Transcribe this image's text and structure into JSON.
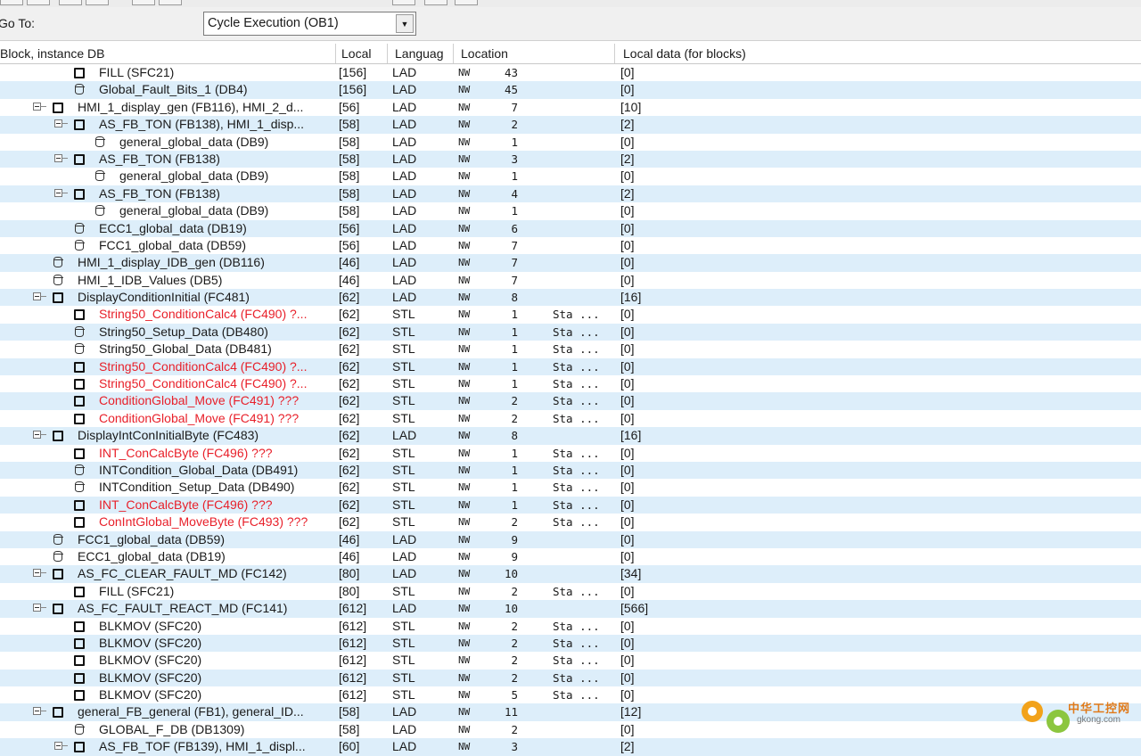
{
  "goto": {
    "label": "Go To:",
    "value": "Cycle Execution (OB1)"
  },
  "columns": [
    "Block, instance DB",
    "Local",
    "Languag",
    "Location",
    "Local data (for blocks)"
  ],
  "rows": [
    {
      "indent": 3,
      "icon": "block",
      "name": "FILL (SFC21)",
      "local": "[156]",
      "lang": "LAD",
      "nw": "NW",
      "num": "43",
      "sta": "",
      "ld": "[0]",
      "red": false
    },
    {
      "indent": 3,
      "icon": "db",
      "name": "Global_Fault_Bits_1 (DB4)",
      "local": "[156]",
      "lang": "LAD",
      "nw": "NW",
      "num": "45",
      "sta": "",
      "ld": "[0]",
      "red": false
    },
    {
      "indent": 2,
      "icon": "block",
      "expand": true,
      "name": "HMI_1_display_gen (FB116), HMI_2_d...",
      "local": "[56]",
      "lang": "LAD",
      "nw": "NW",
      "num": "7",
      "sta": "",
      "ld": "[10]",
      "red": false
    },
    {
      "indent": 3,
      "icon": "block",
      "expand": true,
      "name": "AS_FB_TON (FB138), HMI_1_disp...",
      "local": "[58]",
      "lang": "LAD",
      "nw": "NW",
      "num": "2",
      "sta": "",
      "ld": "[2]",
      "red": false
    },
    {
      "indent": 4,
      "icon": "db",
      "name": "general_global_data (DB9)",
      "local": "[58]",
      "lang": "LAD",
      "nw": "NW",
      "num": "1",
      "sta": "",
      "ld": "[0]",
      "red": false
    },
    {
      "indent": 3,
      "icon": "block",
      "expand": true,
      "name": "AS_FB_TON (FB138)",
      "local": "[58]",
      "lang": "LAD",
      "nw": "NW",
      "num": "3",
      "sta": "",
      "ld": "[2]",
      "red": false
    },
    {
      "indent": 4,
      "icon": "db",
      "name": "general_global_data (DB9)",
      "local": "[58]",
      "lang": "LAD",
      "nw": "NW",
      "num": "1",
      "sta": "",
      "ld": "[0]",
      "red": false
    },
    {
      "indent": 3,
      "icon": "block",
      "expand": true,
      "name": "AS_FB_TON (FB138)",
      "local": "[58]",
      "lang": "LAD",
      "nw": "NW",
      "num": "4",
      "sta": "",
      "ld": "[2]",
      "red": false
    },
    {
      "indent": 4,
      "icon": "db",
      "name": "general_global_data (DB9)",
      "local": "[58]",
      "lang": "LAD",
      "nw": "NW",
      "num": "1",
      "sta": "",
      "ld": "[0]",
      "red": false
    },
    {
      "indent": 3,
      "icon": "db",
      "name": "ECC1_global_data (DB19)",
      "local": "[56]",
      "lang": "LAD",
      "nw": "NW",
      "num": "6",
      "sta": "",
      "ld": "[0]",
      "red": false
    },
    {
      "indent": 3,
      "icon": "db",
      "name": "FCC1_global_data (DB59)",
      "local": "[56]",
      "lang": "LAD",
      "nw": "NW",
      "num": "7",
      "sta": "",
      "ld": "[0]",
      "red": false
    },
    {
      "indent": 2,
      "icon": "db",
      "name": "HMI_1_display_IDB_gen (DB116)",
      "local": "[46]",
      "lang": "LAD",
      "nw": "NW",
      "num": "7",
      "sta": "",
      "ld": "[0]",
      "red": false
    },
    {
      "indent": 2,
      "icon": "db",
      "name": "HMI_1_IDB_Values (DB5)",
      "local": "[46]",
      "lang": "LAD",
      "nw": "NW",
      "num": "7",
      "sta": "",
      "ld": "[0]",
      "red": false
    },
    {
      "indent": 2,
      "icon": "block",
      "expand": true,
      "name": "DisplayConditionInitial (FC481)",
      "local": "[62]",
      "lang": "LAD",
      "nw": "NW",
      "num": "8",
      "sta": "",
      "ld": "[16]",
      "red": false
    },
    {
      "indent": 3,
      "icon": "block",
      "name": "String50_ConditionCalc4 (FC490) ?...",
      "local": "[62]",
      "lang": "STL",
      "nw": "NW",
      "num": "1",
      "sta": "Sta ...",
      "ld": "[0]",
      "red": true
    },
    {
      "indent": 3,
      "icon": "db",
      "name": "String50_Setup_Data (DB480)",
      "local": "[62]",
      "lang": "STL",
      "nw": "NW",
      "num": "1",
      "sta": "Sta ...",
      "ld": "[0]",
      "red": false
    },
    {
      "indent": 3,
      "icon": "db",
      "name": "String50_Global_Data (DB481)",
      "local": "[62]",
      "lang": "STL",
      "nw": "NW",
      "num": "1",
      "sta": "Sta ...",
      "ld": "[0]",
      "red": false
    },
    {
      "indent": 3,
      "icon": "block",
      "name": "String50_ConditionCalc4 (FC490) ?...",
      "local": "[62]",
      "lang": "STL",
      "nw": "NW",
      "num": "1",
      "sta": "Sta ...",
      "ld": "[0]",
      "red": true
    },
    {
      "indent": 3,
      "icon": "block",
      "name": "String50_ConditionCalc4 (FC490) ?...",
      "local": "[62]",
      "lang": "STL",
      "nw": "NW",
      "num": "1",
      "sta": "Sta ...",
      "ld": "[0]",
      "red": true
    },
    {
      "indent": 3,
      "icon": "block",
      "name": "ConditionGlobal_Move (FC491) ???",
      "local": "[62]",
      "lang": "STL",
      "nw": "NW",
      "num": "2",
      "sta": "Sta ...",
      "ld": "[0]",
      "red": true
    },
    {
      "indent": 3,
      "icon": "block",
      "name": "ConditionGlobal_Move (FC491) ???",
      "local": "[62]",
      "lang": "STL",
      "nw": "NW",
      "num": "2",
      "sta": "Sta ...",
      "ld": "[0]",
      "red": true
    },
    {
      "indent": 2,
      "icon": "block",
      "expand": true,
      "name": "DisplayIntConInitialByte (FC483)",
      "local": "[62]",
      "lang": "LAD",
      "nw": "NW",
      "num": "8",
      "sta": "",
      "ld": "[16]",
      "red": false
    },
    {
      "indent": 3,
      "icon": "block",
      "name": "INT_ConCalcByte (FC496) ???",
      "local": "[62]",
      "lang": "STL",
      "nw": "NW",
      "num": "1",
      "sta": "Sta ...",
      "ld": "[0]",
      "red": true
    },
    {
      "indent": 3,
      "icon": "db",
      "name": "INTCondition_Global_Data (DB491)",
      "local": "[62]",
      "lang": "STL",
      "nw": "NW",
      "num": "1",
      "sta": "Sta ...",
      "ld": "[0]",
      "red": false
    },
    {
      "indent": 3,
      "icon": "db",
      "name": "INTCondition_Setup_Data (DB490)",
      "local": "[62]",
      "lang": "STL",
      "nw": "NW",
      "num": "1",
      "sta": "Sta ...",
      "ld": "[0]",
      "red": false
    },
    {
      "indent": 3,
      "icon": "block",
      "name": "INT_ConCalcByte (FC496) ???",
      "local": "[62]",
      "lang": "STL",
      "nw": "NW",
      "num": "1",
      "sta": "Sta ...",
      "ld": "[0]",
      "red": true
    },
    {
      "indent": 3,
      "icon": "block",
      "name": "ConIntGlobal_MoveByte (FC493) ???",
      "local": "[62]",
      "lang": "STL",
      "nw": "NW",
      "num": "2",
      "sta": "Sta ...",
      "ld": "[0]",
      "red": true
    },
    {
      "indent": 2,
      "icon": "db",
      "name": "FCC1_global_data (DB59)",
      "local": "[46]",
      "lang": "LAD",
      "nw": "NW",
      "num": "9",
      "sta": "",
      "ld": "[0]",
      "red": false
    },
    {
      "indent": 2,
      "icon": "db",
      "name": "ECC1_global_data (DB19)",
      "local": "[46]",
      "lang": "LAD",
      "nw": "NW",
      "num": "9",
      "sta": "",
      "ld": "[0]",
      "red": false
    },
    {
      "indent": 2,
      "icon": "block",
      "expand": true,
      "name": "AS_FC_CLEAR_FAULT_MD (FC142)",
      "local": "[80]",
      "lang": "LAD",
      "nw": "NW",
      "num": "10",
      "sta": "",
      "ld": "[34]",
      "red": false
    },
    {
      "indent": 3,
      "icon": "block",
      "name": "FILL (SFC21)",
      "local": "[80]",
      "lang": "STL",
      "nw": "NW",
      "num": "2",
      "sta": "Sta ...",
      "ld": "[0]",
      "red": false
    },
    {
      "indent": 2,
      "icon": "block",
      "expand": true,
      "name": "AS_FC_FAULT_REACT_MD (FC141)",
      "local": "[612]",
      "lang": "LAD",
      "nw": "NW",
      "num": "10",
      "sta": "",
      "ld": "[566]",
      "red": false
    },
    {
      "indent": 3,
      "icon": "block",
      "name": "BLKMOV (SFC20)",
      "local": "[612]",
      "lang": "STL",
      "nw": "NW",
      "num": "2",
      "sta": "Sta ...",
      "ld": "[0]",
      "red": false
    },
    {
      "indent": 3,
      "icon": "block",
      "name": "BLKMOV (SFC20)",
      "local": "[612]",
      "lang": "STL",
      "nw": "NW",
      "num": "2",
      "sta": "Sta ...",
      "ld": "[0]",
      "red": false
    },
    {
      "indent": 3,
      "icon": "block",
      "name": "BLKMOV (SFC20)",
      "local": "[612]",
      "lang": "STL",
      "nw": "NW",
      "num": "2",
      "sta": "Sta ...",
      "ld": "[0]",
      "red": false
    },
    {
      "indent": 3,
      "icon": "block",
      "name": "BLKMOV (SFC20)",
      "local": "[612]",
      "lang": "STL",
      "nw": "NW",
      "num": "2",
      "sta": "Sta ...",
      "ld": "[0]",
      "red": false
    },
    {
      "indent": 3,
      "icon": "block",
      "name": "BLKMOV (SFC20)",
      "local": "[612]",
      "lang": "STL",
      "nw": "NW",
      "num": "5",
      "sta": "Sta ...",
      "ld": "[0]",
      "red": false
    },
    {
      "indent": 2,
      "icon": "block",
      "expand": true,
      "name": "general_FB_general (FB1), general_ID...",
      "local": "[58]",
      "lang": "LAD",
      "nw": "NW",
      "num": "11",
      "sta": "",
      "ld": "[12]",
      "red": false
    },
    {
      "indent": 3,
      "icon": "db",
      "name": "GLOBAL_F_DB (DB1309)",
      "local": "[58]",
      "lang": "LAD",
      "nw": "NW",
      "num": "2",
      "sta": "",
      "ld": "[0]",
      "red": false
    },
    {
      "indent": 3,
      "icon": "block",
      "expand": true,
      "name": "AS_FB_TOF (FB139), HMI_1_displ...",
      "local": "[60]",
      "lang": "LAD",
      "nw": "NW",
      "num": "3",
      "sta": "",
      "ld": "[2]",
      "red": false
    }
  ],
  "watermark": {
    "cn": "中华工控网",
    "en": "gkong.com"
  }
}
